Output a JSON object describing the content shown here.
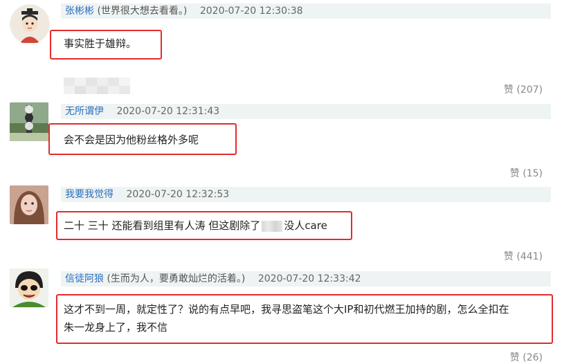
{
  "comments": [
    {
      "username": "张彬彬",
      "signature": "(世界很大想去看看。)",
      "time": "2020-07-20 12:30:38",
      "text": "事实胜于雄辩。",
      "likes": "赞 (207)"
    },
    {
      "username": "无所谓伊",
      "signature": "",
      "time": "2020-07-20 12:31:43",
      "text": "会不会是因为他粉丝格外多呢",
      "likes": "赞 (15)"
    },
    {
      "username": "我要我觉得",
      "signature": "",
      "time": "2020-07-20 12:32:53",
      "text_before": "二十 三十 还能看到组里有人涛 但这剧除了",
      "text_after": "没人care",
      "likes": "赞 (441)"
    },
    {
      "username": "信徒阿狼",
      "signature": "(生而为人，要勇敢灿烂的活着。)",
      "time": "2020-07-20 12:33:42",
      "text_line1": "这才不到一周，就定性了？说的有点早吧，我寻思盗笔这个大IP和初代燃王加持的剧，怎么全扣在",
      "text_line2": "朱一龙身上了，我不信",
      "likes": "赞 (26)"
    }
  ],
  "colors": {
    "highlight": "#e32b2b",
    "username": "#2b6fbf",
    "header_bg": "#eef3f3"
  }
}
